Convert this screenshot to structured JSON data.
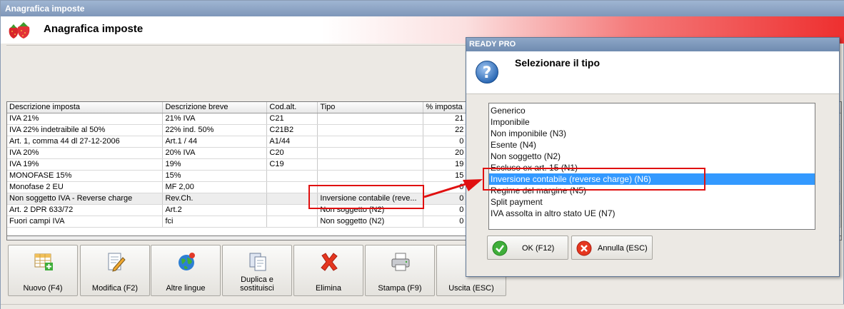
{
  "window": {
    "title": "Anagrafica imposte",
    "header_title": "Anagrafica imposte"
  },
  "grid": {
    "columns": [
      "Descrizione imposta",
      "Descrizione breve",
      "Cod.alt.",
      "Tipo",
      "% imposta"
    ],
    "rows": [
      [
        "IVA 21%",
        "21% IVA",
        "C21",
        "",
        "21"
      ],
      [
        "IVA 22% indetraibile al 50%",
        "22% ind. 50%",
        "C21B2",
        "",
        "22"
      ],
      [
        "Art. 1, comma 44 dl 27-12-2006",
        "Art.1 / 44",
        "A1/44",
        "",
        "0"
      ],
      [
        "IVA 20%",
        "20% IVA",
        "C20",
        "",
        "20"
      ],
      [
        "IVA 19%",
        "19%",
        "C19",
        "",
        "19"
      ],
      [
        "MONOFASE 15%",
        "15%",
        "",
        "",
        "15"
      ],
      [
        "Monofase 2 EU",
        "MF 2,00",
        "",
        "",
        "0"
      ],
      [
        "Non soggetto IVA - Reverse charge",
        "Rev.Ch.",
        "",
        "Inversione contabile (reve...",
        "0"
      ],
      [
        "Art. 2 DPR 633/72",
        "Art.2",
        "",
        "Non soggetto (N2)",
        "0"
      ],
      [
        "Fuori campi IVA",
        "fci",
        "",
        "Non soggetto (N2)",
        "0"
      ]
    ]
  },
  "toolbar": {
    "buttons": [
      {
        "name": "new-button",
        "icon": "grid-add-icon",
        "label": "Nuovo (F4)"
      },
      {
        "name": "edit-button",
        "icon": "edit-document-icon",
        "label": "Modifica (F2)"
      },
      {
        "name": "languages-button",
        "icon": "globe-icon",
        "label": "Altre lingue"
      },
      {
        "name": "duplicate-button",
        "icon": "copy-documents-icon",
        "label": "Duplica e sostituisci"
      },
      {
        "name": "delete-button",
        "icon": "red-x-icon",
        "label": "Elimina"
      },
      {
        "name": "print-button",
        "icon": "printer-icon",
        "label": "Stampa (F9)"
      },
      {
        "name": "exit-button",
        "icon": "exit-icon",
        "label": "Uscita (ESC)"
      }
    ]
  },
  "dialog": {
    "title": "READY PRO",
    "question": "Selezionare il tipo",
    "icon": "question-icon",
    "items": [
      "Generico",
      "Imponibile",
      "Non imponibile (N3)",
      "Esente (N4)",
      "Non soggetto (N2)",
      "Escluso ex art. 15 (N1)",
      "Inversione contabile (reverse charge) (N6)",
      "Regime del margine (N5)",
      "Split payment",
      "IVA assolta in altro stato UE (N7)"
    ],
    "selected_index": 6,
    "ok_label": "OK (F12)",
    "cancel_label": "Annulla (ESC)"
  },
  "colors": {
    "highlight": "#3399ff",
    "annotation": "#e01010",
    "header_accent": "#ee2f2f"
  }
}
